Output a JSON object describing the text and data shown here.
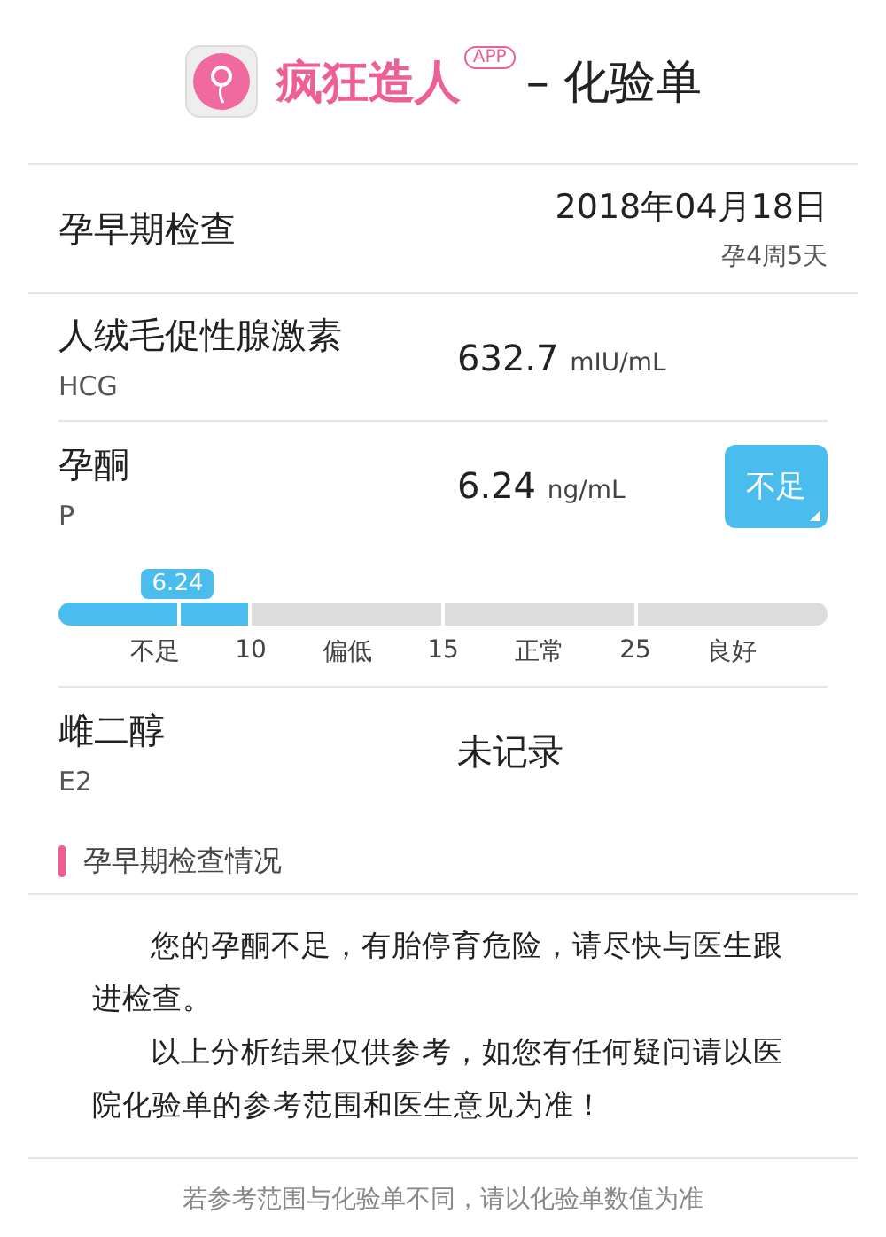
{
  "header": {
    "brand": "疯狂造人",
    "badge": "APP",
    "title": "– 化验单"
  },
  "checkup": {
    "name": "孕早期检查",
    "date": "2018年04月18日",
    "week": "孕4周5天"
  },
  "items": [
    {
      "kind": "value",
      "name": "人绒毛促性腺激素",
      "code": "HCG",
      "value": "632.7",
      "unit": "mIU/mL"
    },
    {
      "kind": "scale",
      "name": "孕酮",
      "code": "P",
      "value": "6.24",
      "unit": "ng/mL",
      "status": "不足",
      "scale": {
        "marker": {
          "label": "6.24",
          "level": 0.155
        },
        "segments": [
          {
            "label": "不足",
            "selected": true
          },
          {
            "label": "偏低",
            "selected": false
          },
          {
            "label": "正常",
            "selected": false
          },
          {
            "label": "良好",
            "selected": false
          }
        ],
        "ticks": [
          "10",
          "15",
          "25"
        ]
      }
    },
    {
      "kind": "empty",
      "name": "雌二醇",
      "code": "E2",
      "value": "未记录"
    }
  ],
  "section": {
    "title": "孕早期检查情况",
    "paragraphs": [
      "您的孕酮不足，有胎停育危险，请尽快与医生跟进检查。",
      "以上分析结果仅供参考，如您有任何疑问请以医院化验单的参考范围和医生意见为准！"
    ]
  },
  "footnote": "若参考范围与化验单不同，请以化验单数值为准"
}
